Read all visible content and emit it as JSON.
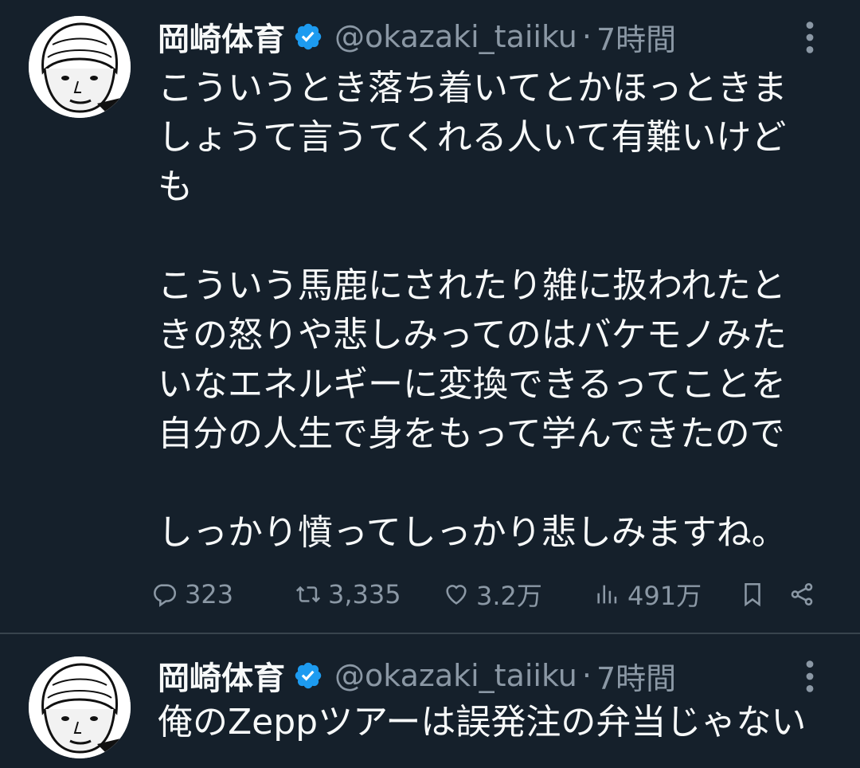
{
  "tweets": [
    {
      "author": {
        "name": "岡崎体育",
        "handle": "@okazaki_taiiku",
        "verified": true
      },
      "time": "7時間",
      "lines": [
        "こういうとき落ち着いてとかほっときま",
        "しょうて言うてくれる人いて有難いけど",
        "も",
        "",
        "こういう馬鹿にされたり雑に扱われたと",
        "きの怒りや悲しみってのはバケモノみた",
        "いなエネルギーに変換できるってことを",
        "自分の人生で身をもって学んできたので",
        "",
        "しっかり憤ってしっかり悲しみますね。"
      ],
      "stats": {
        "replies": "323",
        "retweets": "3,335",
        "likes": "3.2万",
        "views": "491万"
      }
    },
    {
      "author": {
        "name": "岡崎体育",
        "handle": "@okazaki_taiiku",
        "verified": true
      },
      "time": "7時間",
      "lines": [
        "俺のZeppツアーは誤発注の弁当じゃない"
      ]
    }
  ],
  "theme": {
    "background": "#15202b",
    "text": "#f7f9f9",
    "secondary": "#8b98a5",
    "verified": "#1d9bf0",
    "divider": "#38444d"
  },
  "icons": {
    "verified": "verified-badge-icon",
    "more": "more-options-icon",
    "reply": "reply-icon",
    "retweet": "retweet-icon",
    "like": "heart-icon",
    "views": "views-chart-icon",
    "bookmark": "bookmark-icon",
    "share": "share-icon"
  }
}
